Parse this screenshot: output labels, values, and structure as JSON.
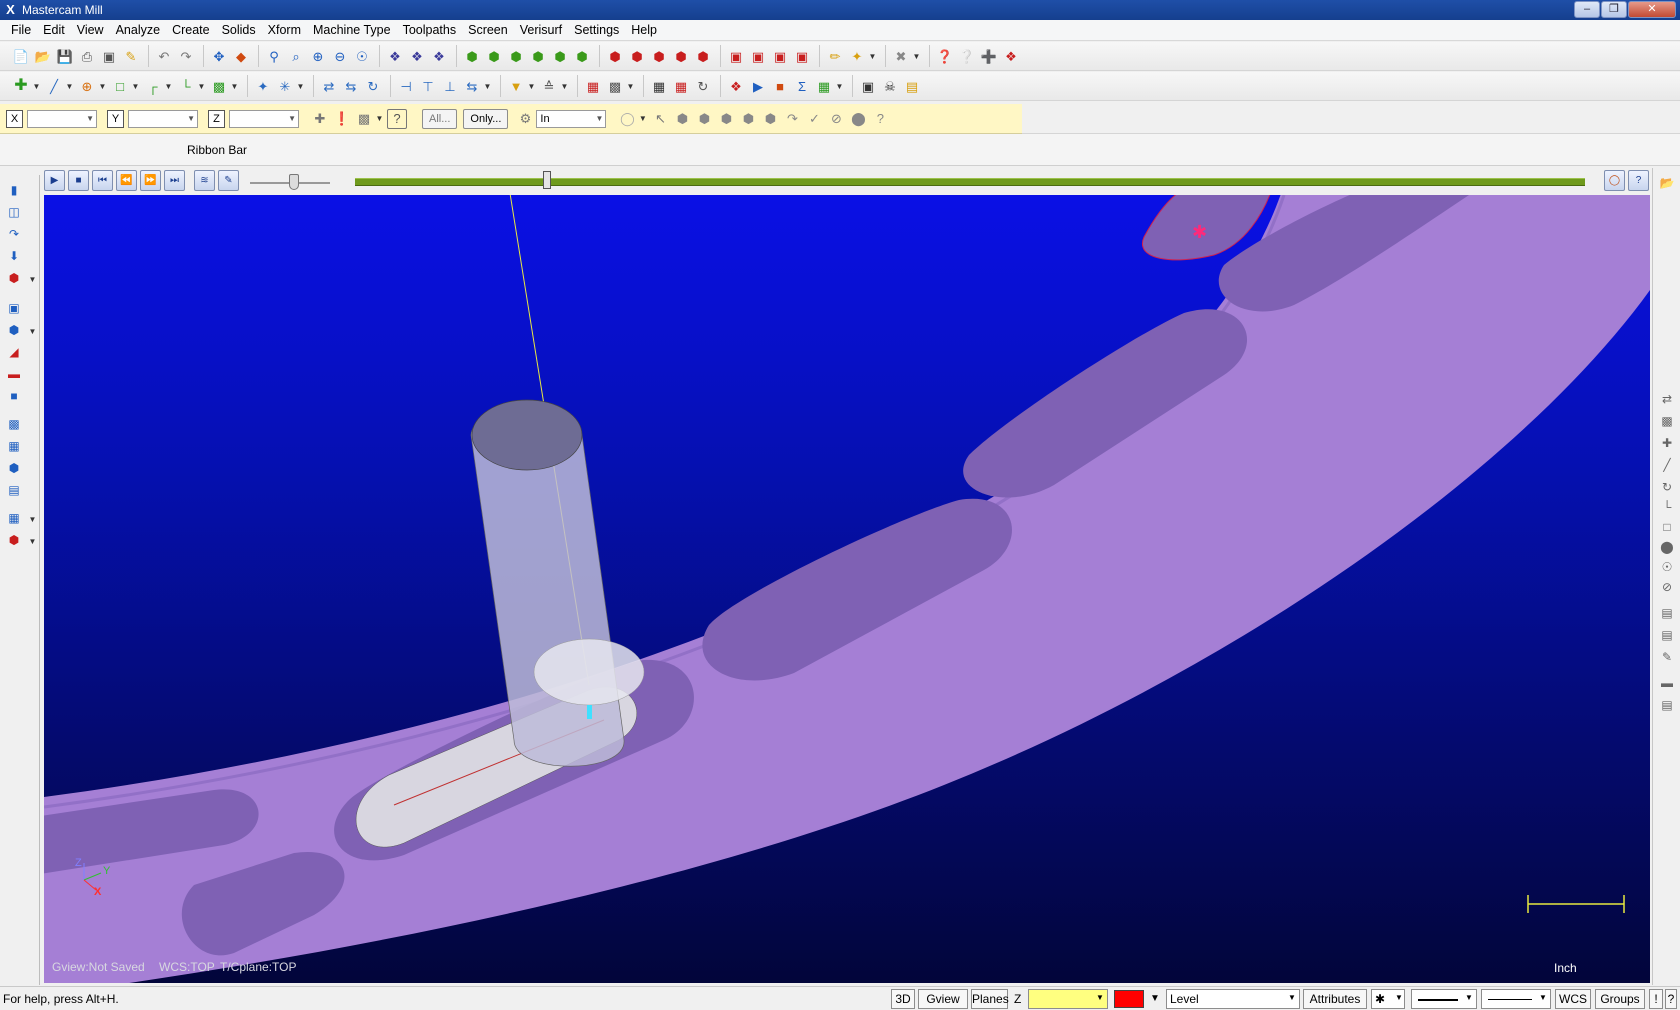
{
  "window": {
    "title": "Mastercam Mill",
    "app_icon": "X"
  },
  "menu": [
    "File",
    "Edit",
    "View",
    "Analyze",
    "Create",
    "Solids",
    "Xform",
    "Machine Type",
    "Toolpaths",
    "Screen",
    "Verisurf",
    "Settings",
    "Help"
  ],
  "coordbar": {
    "x_label": "X",
    "y_label": "Y",
    "z_label": "Z",
    "all_button": "All...",
    "only_button": "Only...",
    "units_value": "In"
  },
  "ribbon": {
    "label": "Ribbon Bar"
  },
  "viewport": {
    "gview_status": "Gview:Not Saved",
    "wcs_status": "WCS:TOP",
    "tcplane_status": "T/Cplane:TOP",
    "scale_label": "Inch",
    "triad_z": "Z",
    "triad_y": "Y",
    "triad_x": "X",
    "colors": {
      "part": "#a77fd6",
      "pocket_shadow": "#7d5fb0",
      "cutter": "#b9b9d8",
      "stock_top": "#e0e0e8"
    }
  },
  "playback": {
    "progress_fraction": 0.156,
    "speed_fraction": 0.55
  },
  "status": {
    "help_text": "For help, press Alt+H.",
    "view_3d": "3D",
    "gview": "Gview",
    "planes": "Planes",
    "z_label": "Z",
    "level_label": "Level",
    "attributes": "Attributes",
    "wcs": "WCS",
    "groups": "Groups",
    "z_field_color": "#ffff80",
    "level_color": "#ff0000"
  }
}
